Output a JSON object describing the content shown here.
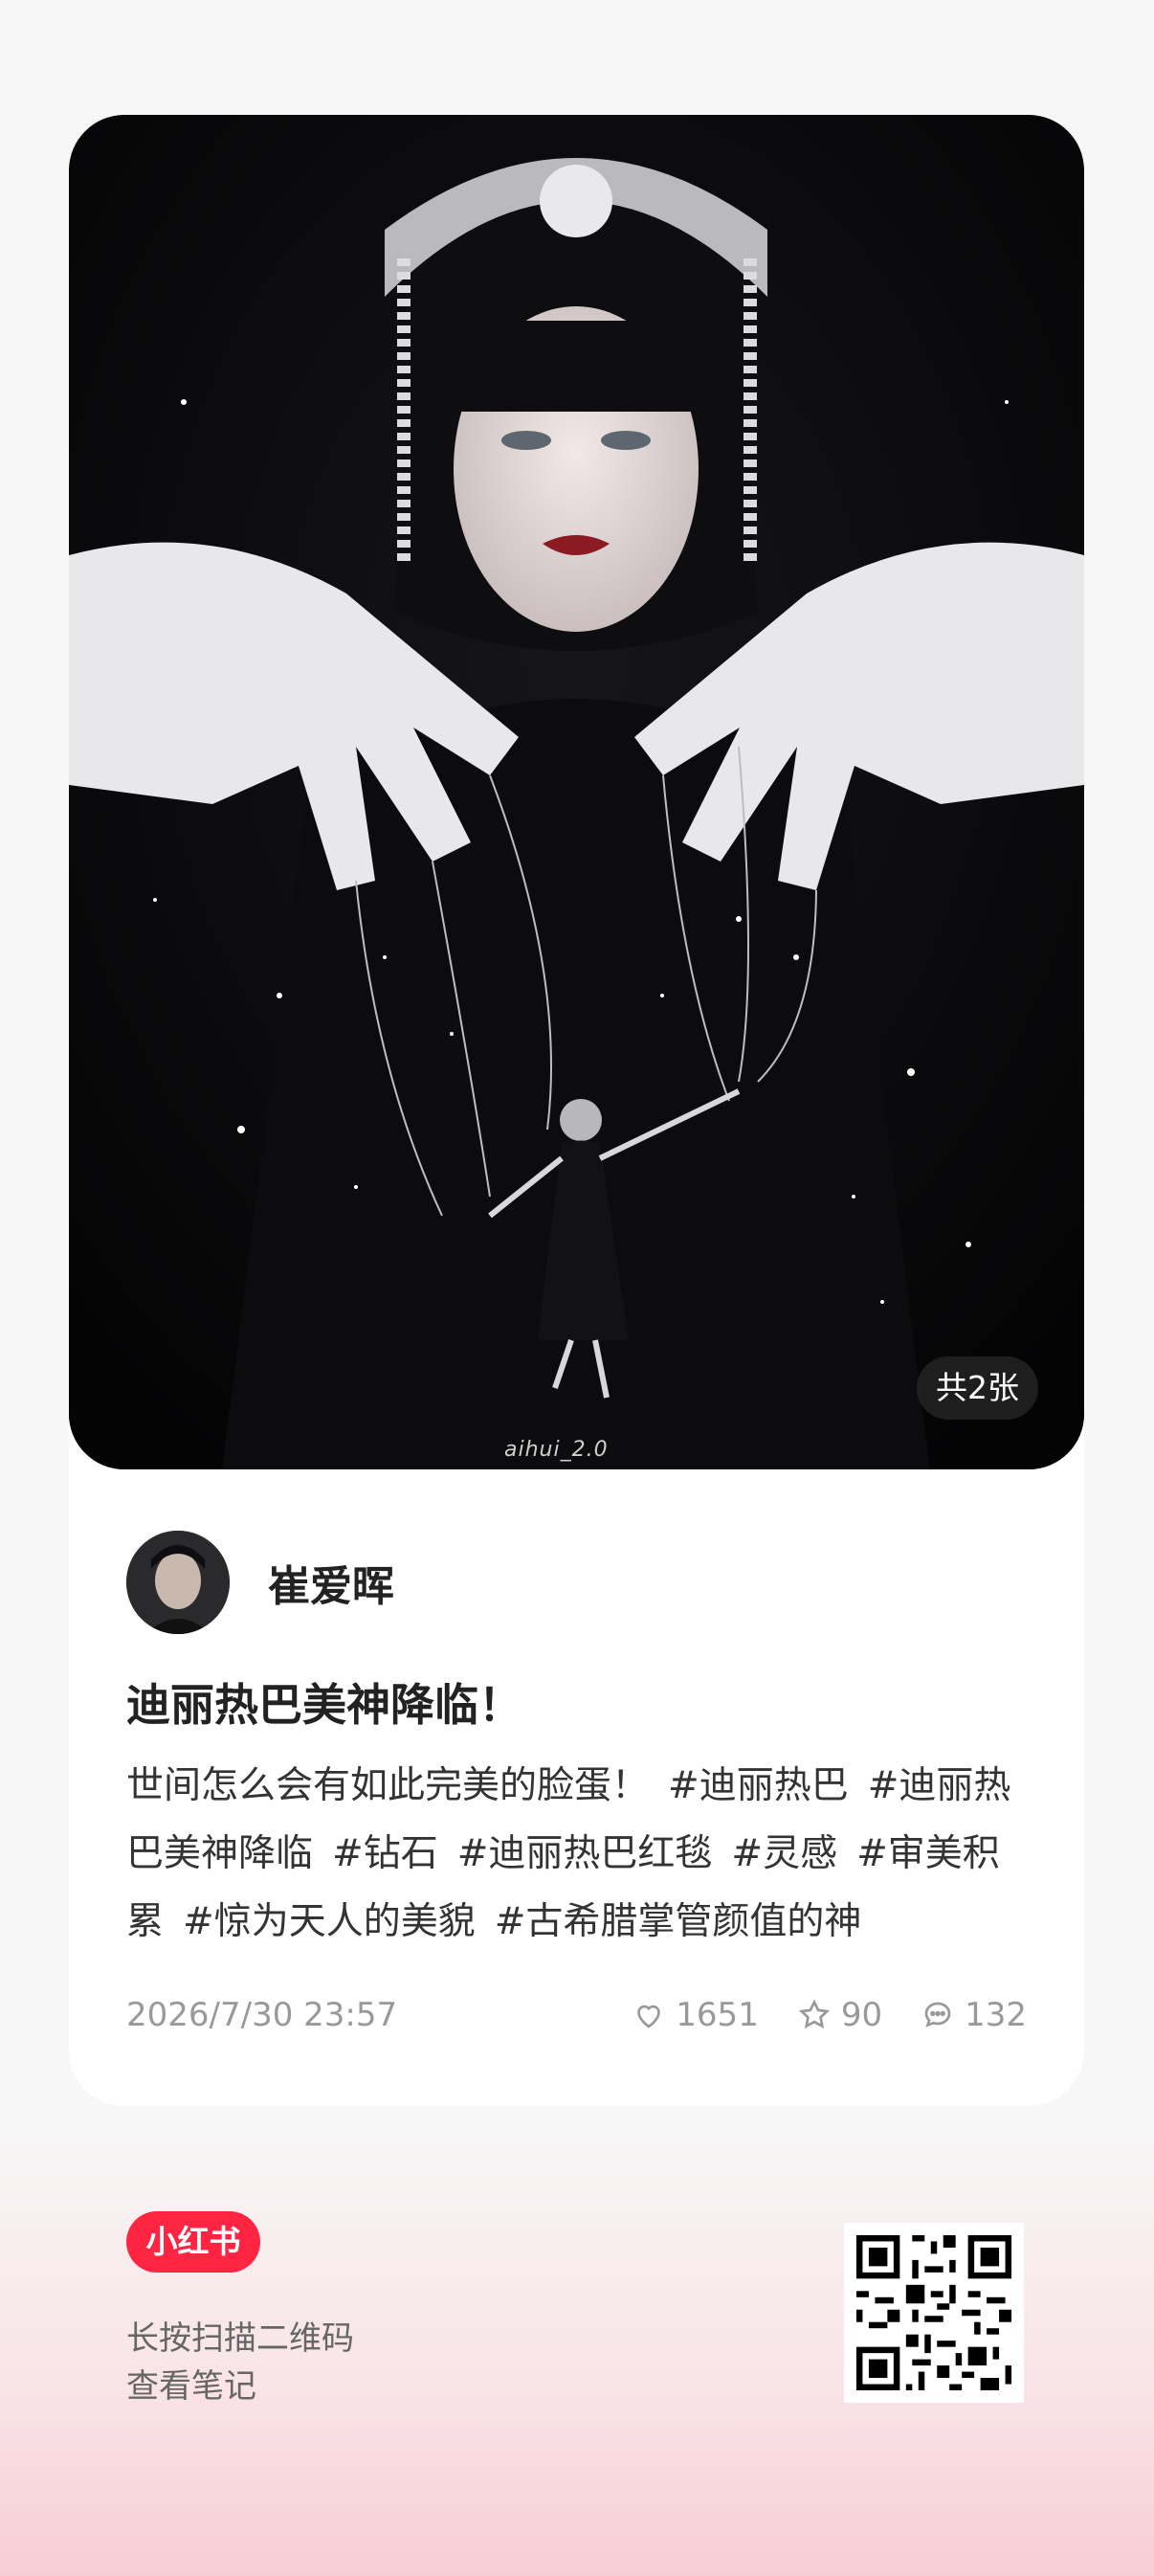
{
  "note": {
    "image_count_label": "共2张",
    "watermark": "aihui_2.0",
    "author_name": "崔爱晖",
    "title": "迪丽热巴美神降临！",
    "body_text": "世间怎么会有如此完美的脸蛋！",
    "tags": [
      "#迪丽热巴",
      "#迪丽热巴美神降临",
      "#钻石",
      "#迪丽热巴红毯",
      "#灵感",
      "#审美积累",
      "#惊为天人的美貌",
      "#古希腊掌管颜值的神"
    ],
    "date": "2026/7/30 23:57",
    "likes": "1651",
    "favorites": "90",
    "comments": "132"
  },
  "footer": {
    "brand": "小红书",
    "line1": "长按扫描二维码",
    "line2": "查看笔记"
  },
  "colors": {
    "brand": "#ff2442",
    "photo_bg": "#060608"
  },
  "icons": [
    "heart-icon",
    "star-icon",
    "comment-icon",
    "qr-code-icon"
  ]
}
